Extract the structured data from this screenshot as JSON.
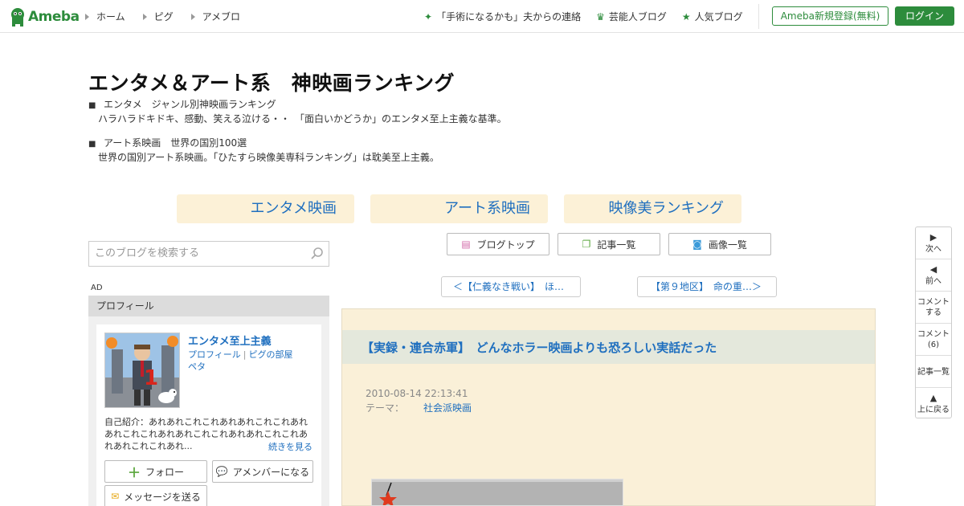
{
  "topbar": {
    "logo_text": "Ameba",
    "nav_left": [
      "ホーム",
      "ピグ",
      "アメブロ"
    ],
    "nav_right": [
      {
        "icon": "diamond-icon",
        "label": "「手術になるかも」夫からの連絡"
      },
      {
        "icon": "crown-icon",
        "label": "芸能人ブログ"
      },
      {
        "icon": "star-icon",
        "label": "人気ブログ"
      }
    ],
    "register_label": "Ameba新規登録(無料)",
    "login_label": "ログイン",
    "accent_color": "#2d8c3c"
  },
  "blog": {
    "title": "エンタメ＆アート系　神映画ランキング",
    "desc1_title": "エンタメ　ジャンル別神映画ランキング",
    "desc1_body": "ハラハラドキドキ、感動、笑える泣ける・・　「面白いかどうか」のエンタメ至上主義な基準。",
    "desc2_title": "アート系映画　世界の国別100選",
    "desc2_body": "世界の国別アート系映画。「ひたすら映像美専科ランキング」は耽美至上主義。",
    "bullet": "■"
  },
  "tabs": [
    "エンタメ映画",
    "アート系映画",
    "映像美ランキング"
  ],
  "search": {
    "placeholder": "このブログを検索する"
  },
  "blog_buttons": [
    {
      "icon": "document-icon",
      "label": "ブログトップ"
    },
    {
      "icon": "pages-icon",
      "label": "記事一覧"
    },
    {
      "icon": "camera-icon",
      "label": "画像一覧"
    }
  ],
  "article_nav": {
    "prev": "＜【仁義なき戦い】　ほ…",
    "next": "【第９地区】　命の重…＞"
  },
  "sidebar": {
    "ad_label": "AD",
    "profile_heading": "プロフィール",
    "name": "エンタメ至上主義",
    "link_profile": "プロフィール",
    "link_pig": "ピグの部屋",
    "link_peta": "ペタ",
    "intro": "自己紹介：あれあれこれこれあれあれこれこれあれあれこれこれあれあれこれこれあれあれこれこれあれあれこれこれあれ...",
    "more": "続きを見る",
    "follow": "フォロー",
    "amember": "アメンバーになる",
    "message": "メッセージを送る"
  },
  "article": {
    "title": "【実録・連合赤軍】　どんなホラー映画よりも恐ろしい実話だった",
    "date": "2010-08-14 22:13:41",
    "theme_label": "テーマ：",
    "theme": "社会派映画"
  },
  "right_nav": {
    "next": "次へ",
    "prev": "前へ",
    "comment": "コメント\nする",
    "comment_count": "コメント\n(6)",
    "list": "記事一覧",
    "top": "上に戻る"
  }
}
